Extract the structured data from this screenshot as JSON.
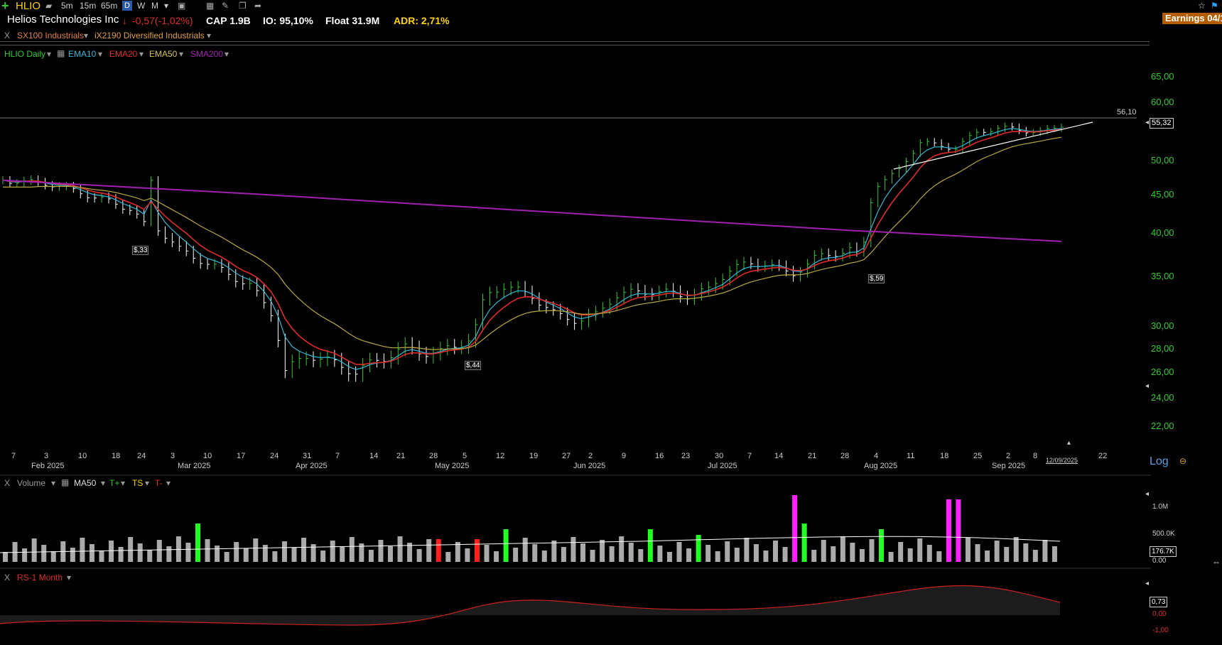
{
  "toolbar": {
    "ticker": "HLIO",
    "timeframes": [
      "5m",
      "15m",
      "65m",
      "D",
      "W",
      "M"
    ]
  },
  "header": {
    "company": "Helios Technologies Inc",
    "change": "-0,57(-1,02%)",
    "cap": "CAP 1.9B",
    "io": "IO: 95,10%",
    "float": "Float 31.9M",
    "adr": "ADR: 2,71%",
    "earnings": "Earnings 04/1"
  },
  "industry": {
    "close": "X",
    "sector": "SX100 Industrials",
    "industry": "iX2190 Diversified Industrials"
  },
  "price_panel": {
    "label": "HLIO Daily",
    "indicators": [
      {
        "name": "EMA10",
        "color": "#2fb8d8"
      },
      {
        "name": "EMA20",
        "color": "#e02a2a"
      },
      {
        "name": "EMA50",
        "color": "#d8c24a"
      },
      {
        "name": "SMA200",
        "color": "#a020b0"
      }
    ],
    "y_ticks": [
      "65,00",
      "60,00",
      "50,00",
      "45,00",
      "40,00",
      "35,00",
      "30,00",
      "28,00",
      "26,00",
      "24,00",
      "22,00"
    ],
    "resistance_label": "56,10",
    "last_price": "55,32",
    "annotations": [
      "$,33",
      "$,44",
      "$,59"
    ],
    "log_label": "Log",
    "date_marker": "12/09/2025"
  },
  "x_axis": {
    "day_ticks": [
      "7",
      "3",
      "10",
      "18",
      "24",
      "3",
      "10",
      "17",
      "24",
      "31",
      "7",
      "14",
      "21",
      "28",
      "5",
      "12",
      "19",
      "27",
      "2",
      "9",
      "16",
      "23",
      "30",
      "7",
      "14",
      "21",
      "28",
      "4",
      "11",
      "18",
      "25",
      "2",
      "8",
      "22"
    ],
    "months": [
      "Feb 2025",
      "Mar 2025",
      "Apr 2025",
      "May 2025",
      "Jun 2025",
      "Jul 2025",
      "Aug 2025",
      "Sep 2025"
    ]
  },
  "volume_panel": {
    "close": "X",
    "label": "Volume",
    "ma_label": "MA50",
    "tplus": "T+",
    "ts": "TS",
    "tminus": "T-",
    "y_ticks": [
      "1.0M",
      "500.0K",
      "0.00"
    ],
    "current": "176.7K"
  },
  "rs_panel": {
    "close": "X",
    "label": "RS-1 Month",
    "current": "0,73",
    "y_ticks": [
      "0,00",
      "-1,00"
    ]
  },
  "colors": {
    "bar_up": "#2ecc2e",
    "bar_down": "#ffffff",
    "ema10": "#2fb8d8",
    "ema20": "#e02a2a",
    "ema50": "#b8a840",
    "sma200": "#a020b0",
    "vol_normal": "#aaaaaa",
    "vol_green": "#22ff22",
    "vol_red": "#ff2020",
    "vol_magenta": "#ff22ff",
    "rs_line": "#d02020"
  }
}
